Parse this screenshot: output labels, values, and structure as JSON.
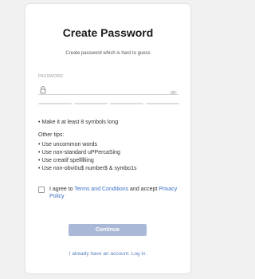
{
  "card": {
    "title": "Create Password",
    "subtitle": "Create password which is hard to guess"
  },
  "password_field": {
    "label": "PASSWORD",
    "value": "",
    "placeholder": "",
    "lock_icon": "lock-icon",
    "visibility_icon": "eye-icon"
  },
  "strength_meter": {
    "segments": 4,
    "filled": 0,
    "empty_color": "#dedede"
  },
  "tips": {
    "main": "• Make it at least 8 symbols long",
    "header": "Other tips:",
    "items": [
      "• Use uncommon words",
      "• Use non-standard uPPercaSing",
      "• Use creatif spellllliing",
      "• Use non-obvi0u$ number$ & symbo1s"
    ]
  },
  "agreement": {
    "checked": false,
    "prefix": "I agree to ",
    "terms_link": "Terms and Conditions",
    "middle": " and accept ",
    "privacy_link": "Privacy Policy"
  },
  "continue_button": {
    "label": "Continue",
    "color": "#a9b8d6"
  },
  "footer": {
    "login_text": "I already have an account. Log in."
  },
  "colors": {
    "link": "#3b6fc5",
    "background": "#f1f1f1"
  }
}
